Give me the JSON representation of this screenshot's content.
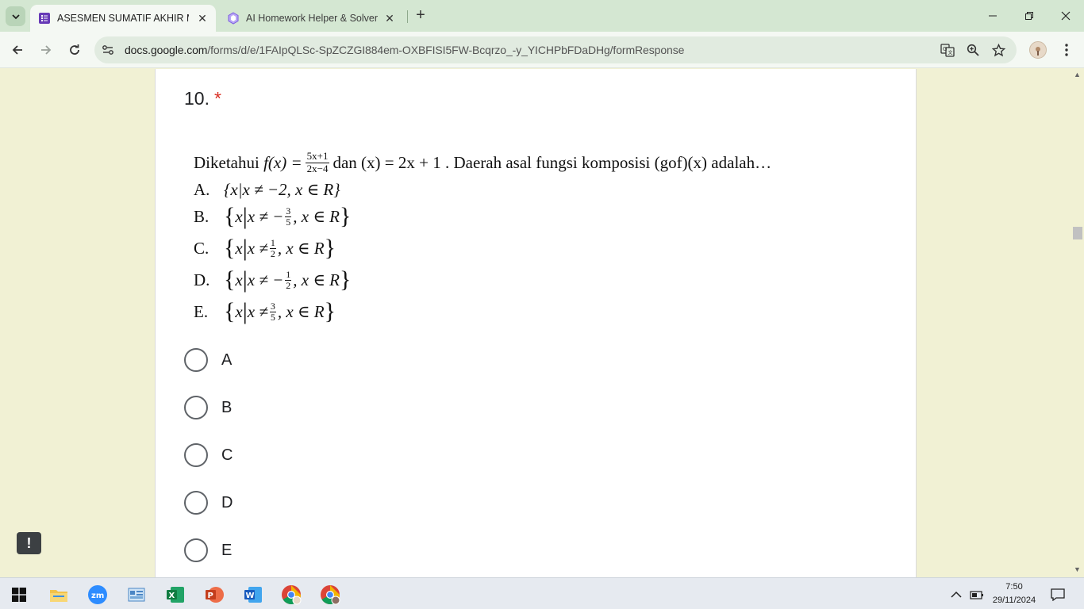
{
  "browser": {
    "tabs": [
      {
        "title": "ASESMEN SUMATIF AKHIR MAT",
        "active": true,
        "icon": "google-forms-icon"
      },
      {
        "title": "AI Homework Helper & Solver -",
        "active": false,
        "icon": "ai-helper-icon"
      }
    ],
    "url_host": "docs.google.com",
    "url_path": "/forms/d/e/1FAIpQLSc-SpZCZGI884em-OXBFISI5FW-Bcqrzo_-y_YICHPbFDaDHg/formResponse"
  },
  "question": {
    "number": "10.",
    "required_marker": "*",
    "text_intro": "Diketahui",
    "fx": "f(x) =",
    "frac_num": "5x+1",
    "frac_den": "2x−4",
    "text_dan": "dan (x) = 2x + 1 . Daerah asal fungsi komposisi (gof)(x) adalah…",
    "options": [
      {
        "letter": "A.",
        "expr": "{x|x ≠ −2, x ∈ R}"
      },
      {
        "letter": "B.",
        "pre": "x ≠ −",
        "num": "3",
        "den": "5",
        "post": ", x ∈ R"
      },
      {
        "letter": "C.",
        "pre": "x ≠ ",
        "num": "1",
        "den": "2",
        "post": ", x ∈ R"
      },
      {
        "letter": "D.",
        "pre": "x ≠ −",
        "num": "1",
        "den": "2",
        "post": ", x ∈ R"
      },
      {
        "letter": "E.",
        "pre": "x ≠ ",
        "num": "3",
        "den": "5",
        "post": ", x ∈ R"
      }
    ]
  },
  "choices": [
    "A",
    "B",
    "C",
    "D",
    "E"
  ],
  "feedback_icon": "!",
  "taskbar": {
    "time": "7:50",
    "date": "29/11/2024"
  }
}
